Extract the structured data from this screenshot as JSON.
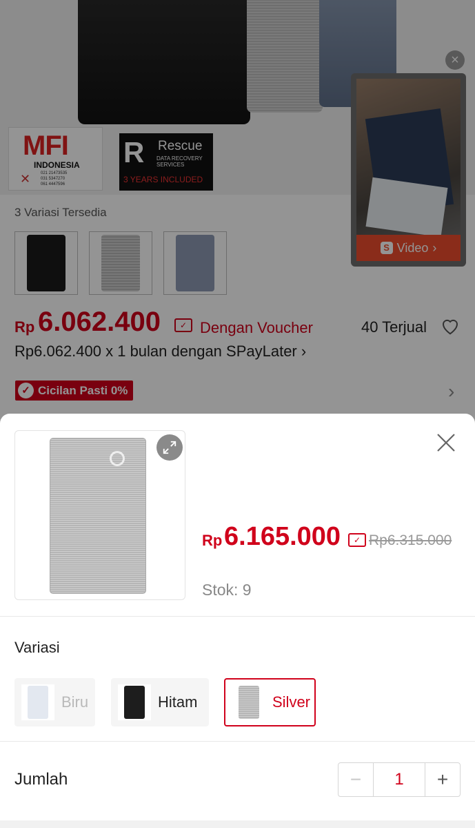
{
  "background": {
    "mfi_badge": {
      "logo": "MFI",
      "country": "INDONESIA",
      "phones": [
        "021 21473535",
        "031 5347270",
        "061 4447596"
      ]
    },
    "rescue_badge": {
      "title": "Rescue",
      "subtitle": "DATA RECOVERY SERVICES",
      "years": "3 YEARS INCLUDED"
    },
    "video_button_label": "Video",
    "variants_label": "3 Variasi Tersedia",
    "price_currency": "Rp",
    "price": "6.062.400",
    "voucher_label": "Dengan Voucher",
    "sold_label": "40 Terjual",
    "spaylater": "Rp6.062.400 x 1 bulan dengan SPayLater",
    "cicilan_label": "Cicilan Pasti 0%"
  },
  "sheet": {
    "price_currency": "Rp",
    "price": "6.165.000",
    "original_price": "Rp6.315.000",
    "stock": "Stok: 9",
    "variation_title": "Variasi",
    "options": [
      {
        "label": "Biru",
        "state": "disabled"
      },
      {
        "label": "Hitam",
        "state": "available"
      },
      {
        "label": "Silver",
        "state": "selected"
      }
    ],
    "quantity_label": "Jumlah",
    "quantity": "1"
  },
  "colors": {
    "accent": "#d0011b",
    "shopee_orange": "#ee4d2d",
    "muted_text": "#888888"
  },
  "icons": [
    "close-icon",
    "expand-icon",
    "heart-icon",
    "voucher-icon",
    "chevron-right-icon",
    "check-icon",
    "video-play-icon",
    "minus-icon",
    "plus-icon"
  ]
}
